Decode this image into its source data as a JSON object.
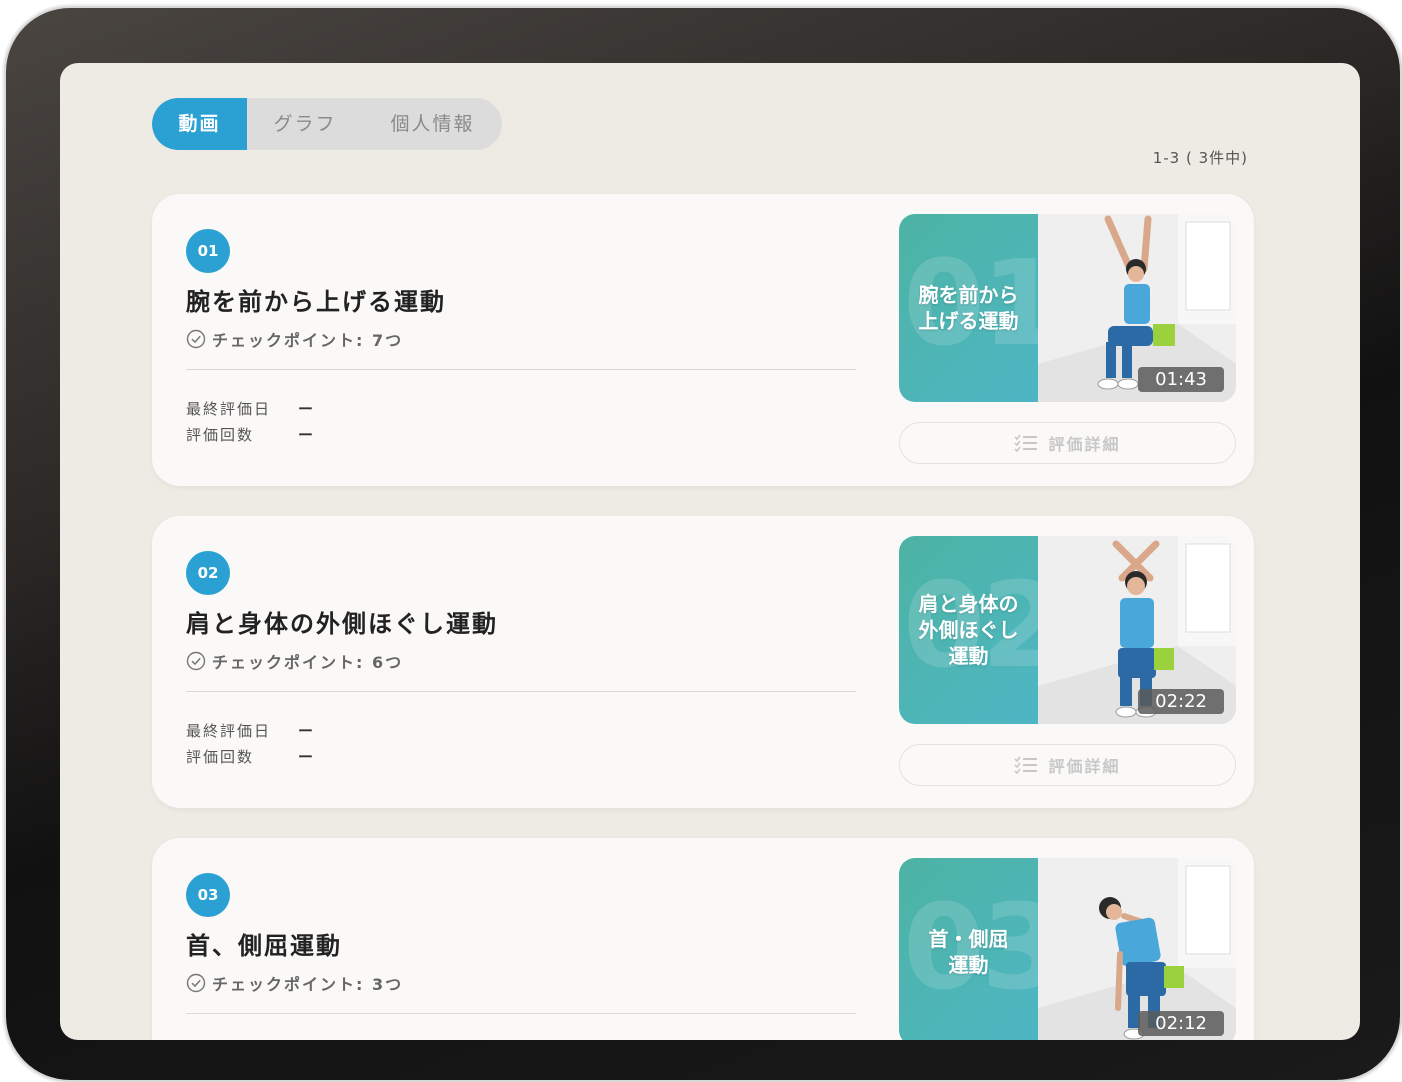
{
  "tabs": [
    {
      "label": "動画",
      "active": true
    },
    {
      "label": "グラフ",
      "active": false
    },
    {
      "label": "個人情報",
      "active": false
    }
  ],
  "count_text": "1-3 ( 3件中)",
  "labels": {
    "last_eval": "最終評価日",
    "eval_count": "評価回数",
    "detail_button": "評価詳細"
  },
  "colors": {
    "accent": "#2ba1d3",
    "thumb_teal": "#4db3a4",
    "background": "#eeebe5"
  },
  "cards": [
    {
      "number": "01",
      "title": "腕を前から上げる運動",
      "checkpoint": "チェックポイント: 7つ",
      "last_eval_value": "ー",
      "eval_count_value": "ー",
      "thumb_num": "01",
      "thumb_lines": [
        "腕を前から",
        "上げる運動"
      ],
      "duration": "01:43"
    },
    {
      "number": "02",
      "title": "肩と身体の外側ほぐし運動",
      "checkpoint": "チェックポイント: 6つ",
      "last_eval_value": "ー",
      "eval_count_value": "ー",
      "thumb_num": "02",
      "thumb_lines": [
        "肩と身体の",
        "外側ほぐし",
        "運動"
      ],
      "duration": "02:22"
    },
    {
      "number": "03",
      "title": "首、側屈運動",
      "checkpoint": "チェックポイント: 3つ",
      "thumb_num": "03",
      "thumb_lines": [
        "首・側屈",
        "運動"
      ],
      "duration": "02:12"
    }
  ]
}
